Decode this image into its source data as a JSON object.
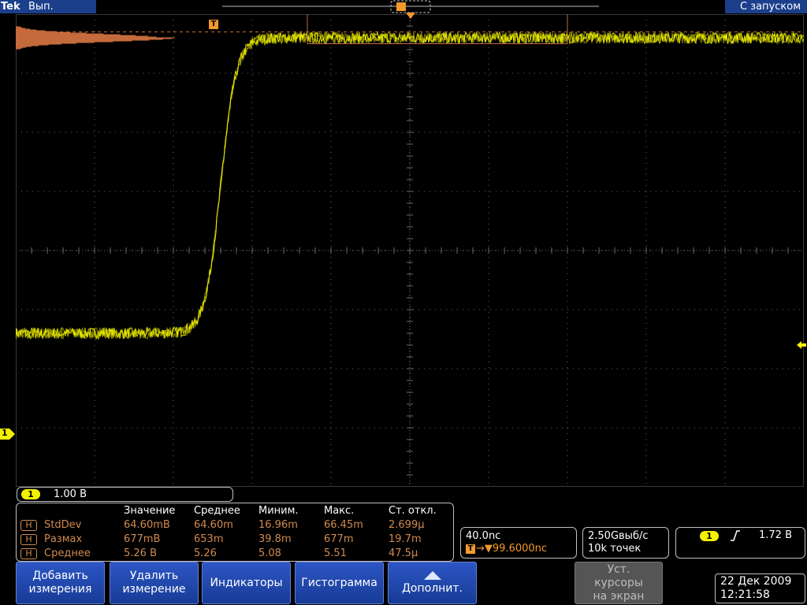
{
  "topbar": {
    "brand": "Tek",
    "acquisition_state": "Вып.",
    "trigger_mode": "С запуском"
  },
  "markers": {
    "trigger_position_label": "T",
    "channel_label": "1"
  },
  "colors": {
    "trace": "#f2f200",
    "histogram": "#c46a3b",
    "grid": "#6a6a6a",
    "measurement": "#d08a50",
    "button": "#2449b0"
  },
  "channel": {
    "badge": "1",
    "scale": "1.00 В"
  },
  "measurements": {
    "headers": [
      "Значение",
      "Среднее",
      "Миним.",
      "Макс.",
      "Ст. откл."
    ],
    "rows": [
      {
        "badge": "H",
        "name": "StdDev",
        "values": [
          "64.60mВ",
          "64.60m",
          "16.96m",
          "66.45m",
          "2.699µ"
        ]
      },
      {
        "badge": "H",
        "name": "Размах",
        "values": [
          "677mВ",
          "653m",
          "39.8m",
          "677m",
          "19.7m"
        ]
      },
      {
        "badge": "H",
        "name": "Среднее",
        "values": [
          "5.26 В",
          "5.26",
          "5.08",
          "5.51",
          "47.5µ"
        ]
      }
    ]
  },
  "horizontal": {
    "time_per_div": "40.0nс",
    "trigger_symbol": "T",
    "delay": "→▼99.6000nс"
  },
  "acquisition": {
    "sample_rate": "2.50Gвыб/с",
    "record_length": "10k точек"
  },
  "trigger": {
    "badge": "1",
    "slope_icon": "rising-edge-icon",
    "level": "1.72 В"
  },
  "buttons": {
    "add_line1": "Добавить",
    "add_line2": "измерения",
    "remove_line1": "Удалить",
    "remove_line2": "измерение",
    "indicators": "Индикаторы",
    "histogram": "Гистограмма",
    "more": "Дополнит.",
    "cursors_line1": "Уст.",
    "cursors_line2": "курсоры",
    "cursors_line3": "на экран"
  },
  "datetime": {
    "date": "22 Дек 2009",
    "time": "12:21:58"
  },
  "waveform": {
    "low_level_v": -1.4,
    "high_level_v": 3.6,
    "rise_center_div": 2.6,
    "rise_width_div": 0.2,
    "noise_v": 0.06
  },
  "histogram_box": {
    "x_start_div": 3.7,
    "x_end_div": 7.0,
    "y_top_v": 4.5,
    "y_bottom_v": 3.5
  },
  "chart_data": {
    "type": "line",
    "x_divisions": 10,
    "y_divisions": 8,
    "series": [
      {
        "values_div": [
          [
            0,
            -1.4
          ],
          [
            2.2,
            -1.4
          ],
          [
            2.4,
            -1.2
          ],
          [
            2.6,
            0.8
          ],
          [
            2.8,
            3.1
          ],
          [
            3.1,
            3.6
          ],
          [
            10,
            3.6
          ]
        ]
      }
    ]
  }
}
